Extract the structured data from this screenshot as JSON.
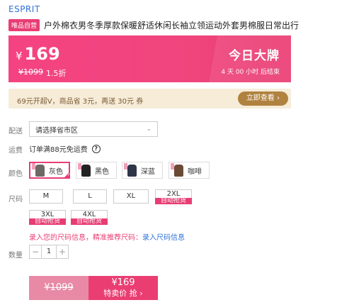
{
  "brand": "ESPRIT",
  "product": {
    "badge": "唯品自营",
    "title": "户外棉衣男冬季厚款保暖舒适休闲长袖立领运动外套男棉服日常出行"
  },
  "price": {
    "currency": "¥",
    "current": "169",
    "original": "¥1099",
    "discount": "1.5折",
    "promo_title": "今日大牌",
    "countdown": "4 天 00 小时 后结束"
  },
  "coupon": {
    "text": "69元开超V，商品省 3元，再送 30元 券",
    "button": "立即查看 ›"
  },
  "delivery": {
    "label": "配送",
    "placeholder": "请选择省市区",
    "chevron": "chevron-down-icon"
  },
  "shipping": {
    "label": "运费",
    "text": "订单满88元免运费",
    "icon": "?"
  },
  "color": {
    "label": "颜色",
    "options": [
      {
        "name": "灰色",
        "swatch": "#6d6a66",
        "selected": true
      },
      {
        "name": "黑色",
        "swatch": "#222222",
        "selected": false
      },
      {
        "name": "深蓝",
        "swatch": "#2e3548",
        "selected": false
      },
      {
        "name": "咖啡",
        "swatch": "#6b4a35",
        "selected": false
      }
    ]
  },
  "size": {
    "label": "尺码",
    "options": [
      {
        "name": "M",
        "tag": ""
      },
      {
        "name": "L",
        "tag": ""
      },
      {
        "name": "XL",
        "tag": ""
      },
      {
        "name": "2XL",
        "tag": "自动抢货"
      },
      {
        "name": "3XL",
        "tag": "自动抢货"
      },
      {
        "name": "4XL",
        "tag": "自动抢货"
      }
    ],
    "hint_prefix": "录入您的尺码信息，精准推荐尺码：",
    "hint_link": "录入尺码信息"
  },
  "quantity": {
    "label": "数量",
    "minus": "−",
    "value": "1",
    "plus": "+"
  },
  "buy": {
    "original": "¥1099",
    "price": "¥169",
    "action": "特卖价 抢 ›"
  },
  "colors": {
    "accent": "#e83d74",
    "link": "#2f72d8",
    "coupon_bg": "#f6ecd8",
    "coupon_btn": "#b0823f"
  }
}
